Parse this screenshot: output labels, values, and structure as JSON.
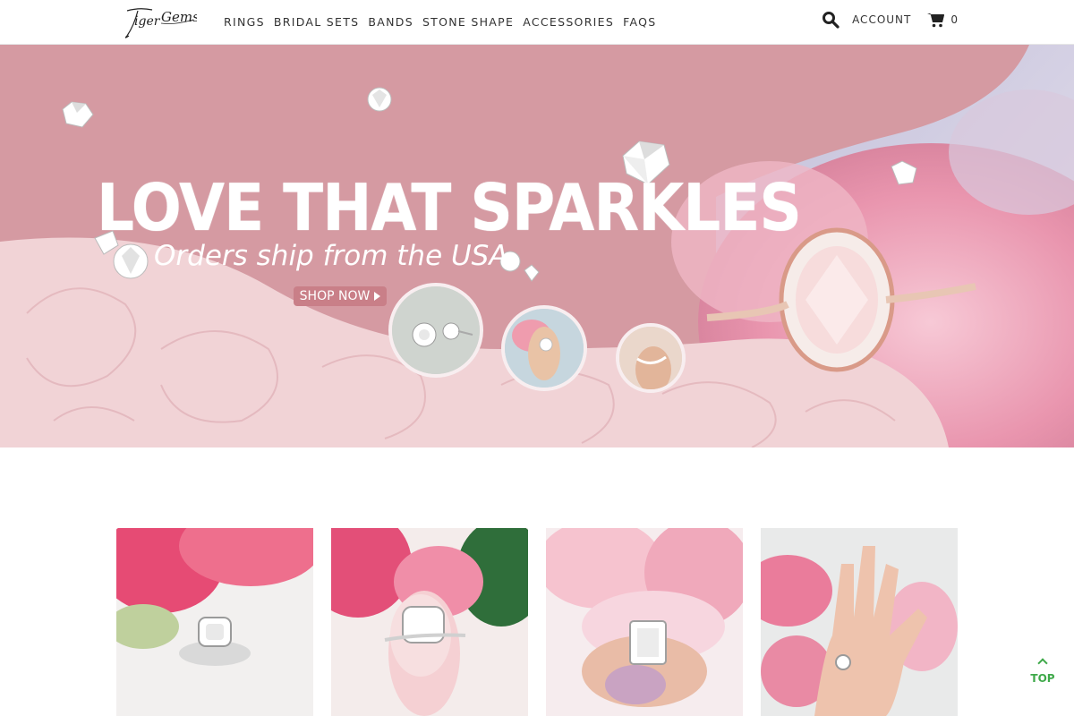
{
  "brand": {
    "logo_text": "TigerGems"
  },
  "nav": {
    "items": [
      "RINGS",
      "BRIDAL SETS",
      "BANDS",
      "STONE SHAPE",
      "ACCESSORIES",
      "FAQS"
    ]
  },
  "header": {
    "account_label": "ACCOUNT",
    "cart_count": "0",
    "search_icon": "search-icon",
    "cart_icon": "cart-icon"
  },
  "hero": {
    "title": "LOVE THAT SPARKLES",
    "subtitle": "Orders ship from the USA",
    "cta_label": "SHOP NOW",
    "colors": {
      "primary_pink": "#d59aa2",
      "light_pink": "#f1d3d6",
      "lavender": "#c9c3dc"
    }
  },
  "products": [
    {
      "name": "halo-cushion-ring"
    },
    {
      "name": "cushion-solitaire-ring"
    },
    {
      "name": "emerald-cut-ring"
    },
    {
      "name": "round-solitaire-ring"
    }
  ],
  "back_to_top": {
    "label": "TOP",
    "color": "#3fa94a"
  }
}
